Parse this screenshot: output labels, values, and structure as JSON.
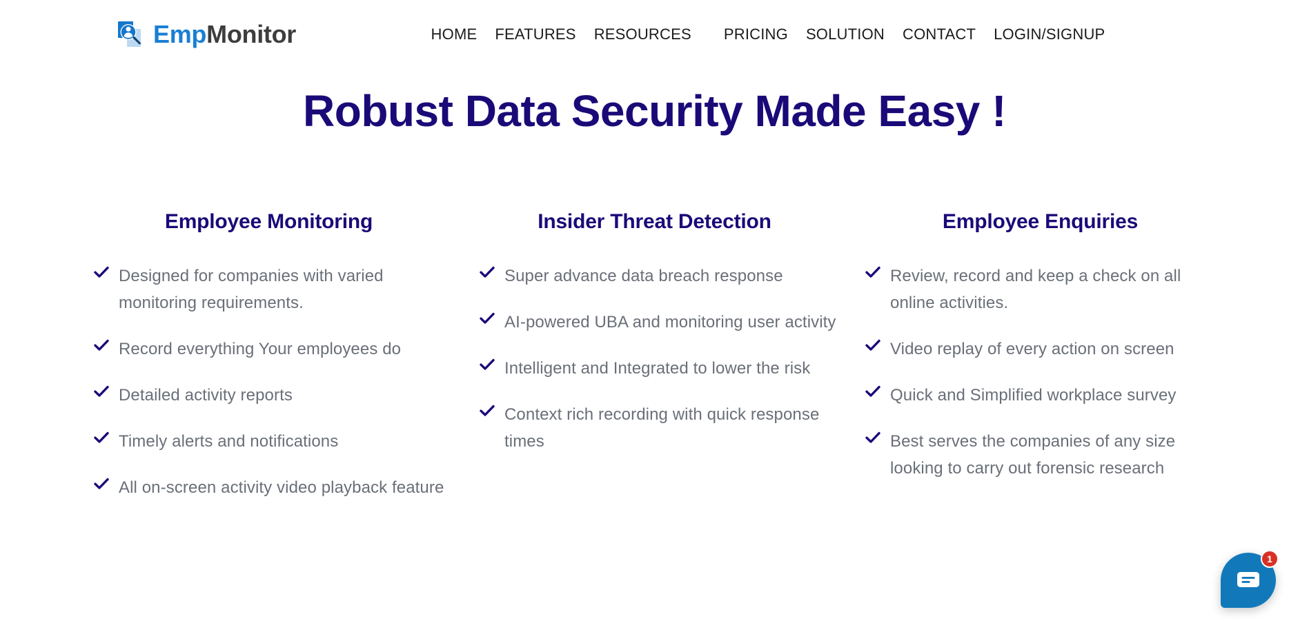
{
  "brand": {
    "name_part1": "Emp",
    "name_part2": "Monitor",
    "logo_icon": "magnifier-person-icon",
    "accent_blue": "#1a7fd4",
    "dark_gray": "#3d3d3d"
  },
  "nav": {
    "items": [
      {
        "label": "HOME"
      },
      {
        "label": "FEATURES"
      },
      {
        "label": "RESOURCES"
      },
      {
        "label": "PRICING"
      },
      {
        "label": "SOLUTION"
      },
      {
        "label": "CONTACT"
      },
      {
        "label": "LOGIN/SIGNUP"
      }
    ]
  },
  "hero": {
    "title": "Robust Data Security Made Easy !",
    "title_color": "#1a0a78"
  },
  "columns": [
    {
      "title": "Employee Monitoring",
      "items": [
        "Designed for companies with varied monitoring requirements.",
        "Record everything Your employees do",
        "Detailed activity reports",
        "Timely alerts and notifications",
        "All on-screen activity video playback feature"
      ]
    },
    {
      "title": "Insider Threat Detection",
      "items": [
        "Super advance data breach response",
        "AI-powered UBA and monitoring user activity",
        "Intelligent and Integrated to lower the risk",
        "Context rich recording with quick response times"
      ]
    },
    {
      "title": "Employee Enquiries",
      "items": [
        "Review, record and keep a check on all online activities.",
        "Video replay of every action on screen",
        "Quick and Simplified workplace survey",
        "Best serves the companies of any size looking to carry out forensic research"
      ]
    }
  ],
  "chat": {
    "icon": "chat-message-icon",
    "badge_count": "1",
    "bubble_color": "#1179ba",
    "badge_color": "#d93025"
  }
}
